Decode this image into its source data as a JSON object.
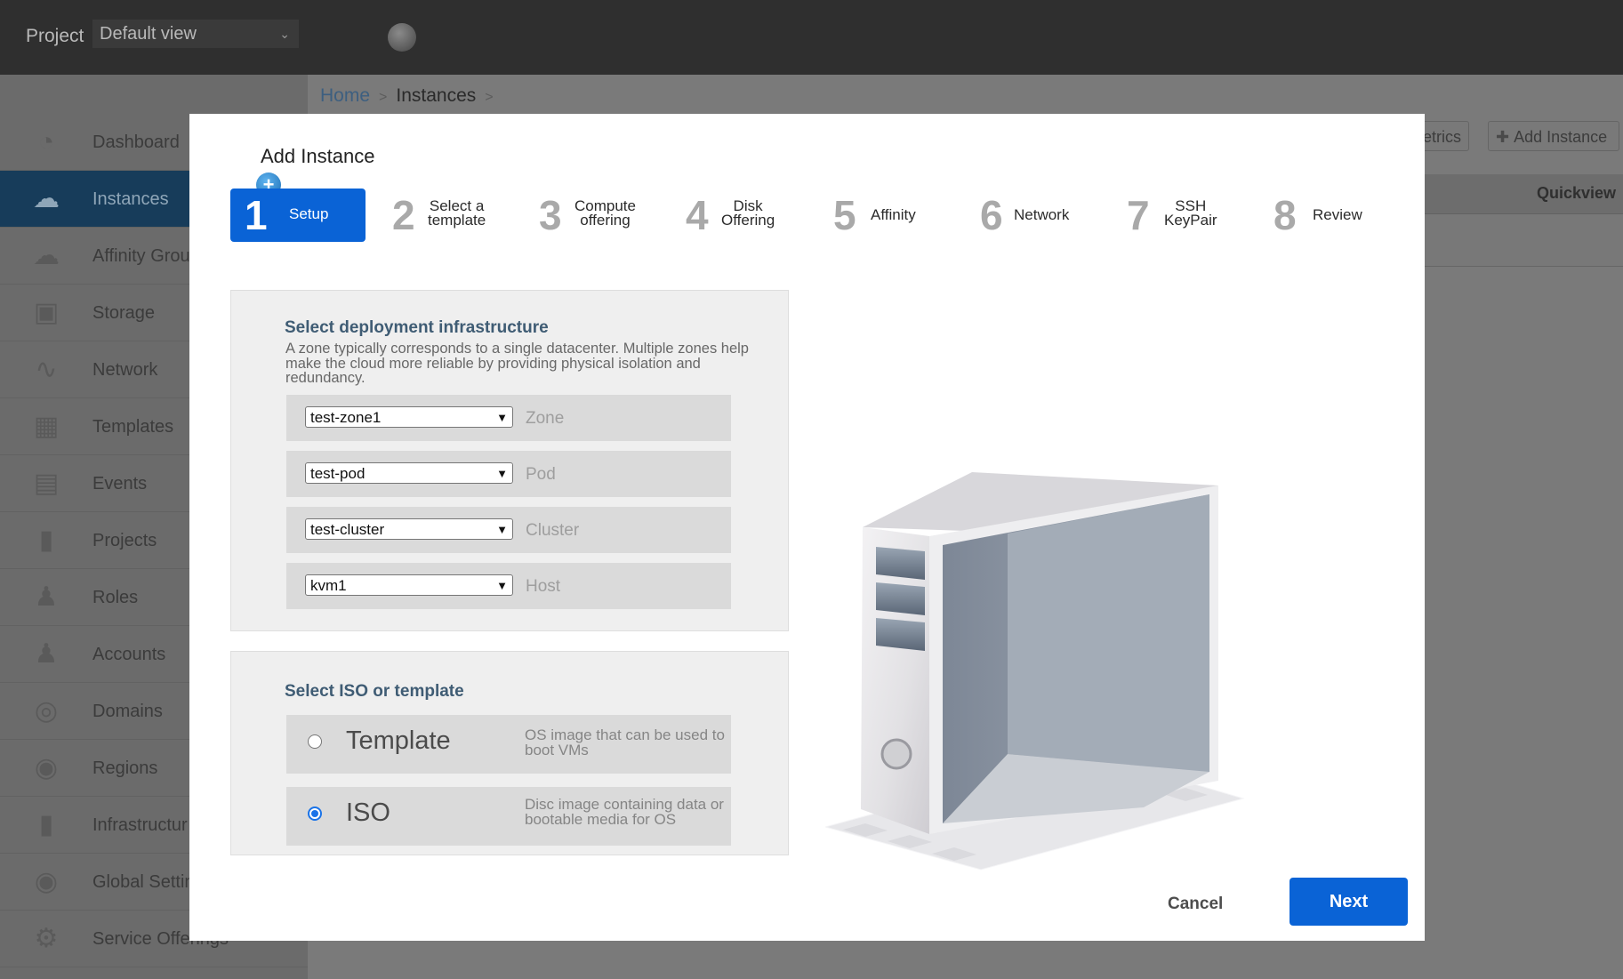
{
  "header": {
    "project_label": "Project",
    "project_view": "Default view"
  },
  "sidebar": {
    "items": [
      {
        "label": "Dashboard",
        "icon": "dashboard-icon"
      },
      {
        "label": "Instances",
        "icon": "cloud-icon",
        "active": true
      },
      {
        "label": "Affinity Grou",
        "icon": "affinity-icon"
      },
      {
        "label": "Storage",
        "icon": "storage-icon"
      },
      {
        "label": "Network",
        "icon": "network-icon"
      },
      {
        "label": "Templates",
        "icon": "templates-icon"
      },
      {
        "label": "Events",
        "icon": "calendar-icon"
      },
      {
        "label": "Projects",
        "icon": "folder-icon"
      },
      {
        "label": "Roles",
        "icon": "roles-icon"
      },
      {
        "label": "Accounts",
        "icon": "user-icon"
      },
      {
        "label": "Domains",
        "icon": "domains-icon"
      },
      {
        "label": "Regions",
        "icon": "globe-icon"
      },
      {
        "label": "Infrastructur",
        "icon": "infrastructure-icon"
      },
      {
        "label": "Global Settin",
        "icon": "globe-settings-icon"
      },
      {
        "label": "Service Offerings",
        "icon": "gear-icon"
      }
    ]
  },
  "breadcrumb": {
    "home": "Home",
    "current": "Instances",
    "sep": ">"
  },
  "toolbar": {
    "metrics_label": "etrics",
    "add_instance_label": "Add Instance"
  },
  "table": {
    "quickview_header": "Quickview"
  },
  "modal": {
    "title": "Add Instance",
    "steps": [
      {
        "num": "1",
        "label": "Setup",
        "active": true
      },
      {
        "num": "2",
        "label": "Select a\ntemplate"
      },
      {
        "num": "3",
        "label": "Compute\noffering"
      },
      {
        "num": "4",
        "label": "Disk\nOffering"
      },
      {
        "num": "5",
        "label": "Affinity"
      },
      {
        "num": "6",
        "label": "Network"
      },
      {
        "num": "7",
        "label": "SSH\nKeyPair"
      },
      {
        "num": "8",
        "label": "Review"
      }
    ],
    "infra": {
      "heading": "Select deployment infrastructure",
      "description": "A zone typically corresponds to a single datacenter. Multiple zones help make the cloud more reliable by providing physical isolation and redundancy.",
      "rows": [
        {
          "value": "test-zone1",
          "label": "Zone"
        },
        {
          "value": "test-pod",
          "label": "Pod"
        },
        {
          "value": "test-cluster",
          "label": "Cluster"
        },
        {
          "value": "kvm1",
          "label": "Host"
        }
      ]
    },
    "iso_template": {
      "heading": "Select ISO or template",
      "options": [
        {
          "name": "Template",
          "description": "OS image that can be used to boot VMs",
          "selected": false
        },
        {
          "name": "ISO",
          "description": "Disc image containing data or bootable media for OS",
          "selected": true
        }
      ]
    },
    "cancel_label": "Cancel",
    "next_label": "Next"
  },
  "colors": {
    "primary_blue": "#0a63d6",
    "heading_blue": "#3f5c74",
    "sidebar_active": "#173c5a"
  }
}
